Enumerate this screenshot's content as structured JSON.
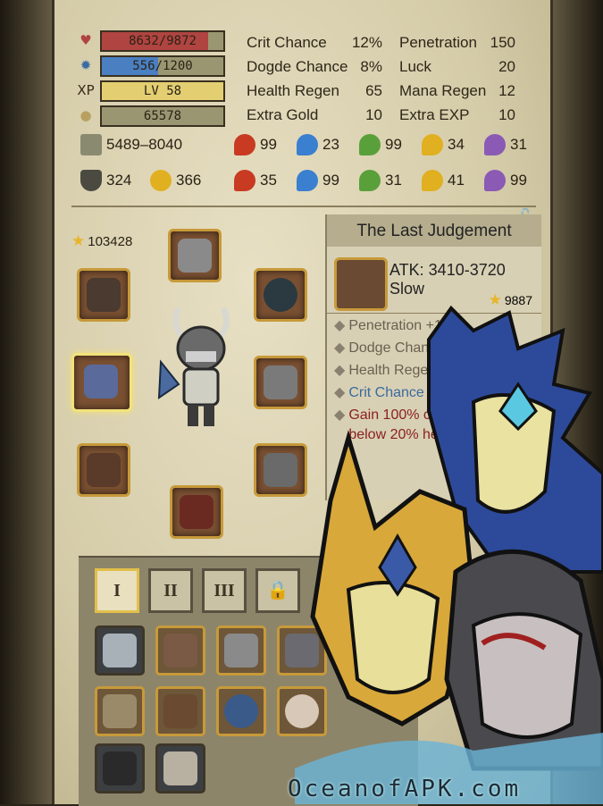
{
  "stats_bars": [
    {
      "icon": "heart-icon",
      "label": "8632/9872",
      "fill": 0.874,
      "color": "#b04440"
    },
    {
      "icon": "mana-icon",
      "label": "556/1200",
      "fill": 0.463,
      "color": "#4a7fc2"
    },
    {
      "icon": "xp-icon",
      "icon_text": "XP",
      "label": "LV 58",
      "fill": 1.0,
      "color": "#e3cf72"
    },
    {
      "icon": "gold-icon",
      "label": "65578",
      "fill": 0,
      "color": "#9b9672"
    }
  ],
  "stats_left": [
    {
      "label": "Crit Chance",
      "value": "12%"
    },
    {
      "label": "Dogde Chance",
      "value": "8%"
    },
    {
      "label": "Health Regen",
      "value": "65"
    },
    {
      "label": "Extra Gold",
      "value": "10"
    }
  ],
  "stats_right": [
    {
      "label": "Penetration",
      "value": "150"
    },
    {
      "label": "Luck",
      "value": "20"
    },
    {
      "label": "Mana Regen",
      "value": "12"
    },
    {
      "label": "Extra EXP",
      "value": "10"
    }
  ],
  "attack": {
    "icon": "crossed-swords-icon",
    "value": "5489–8040"
  },
  "defense": [
    {
      "icon": "shield-icon",
      "value": "324"
    },
    {
      "icon": "magic-staff-icon",
      "value": "366"
    }
  ],
  "elements_atk": [
    {
      "icon": "fire-icon",
      "value": "99",
      "color": "#c83a22"
    },
    {
      "icon": "water-icon",
      "value": "23",
      "color": "#3a7fd0"
    },
    {
      "icon": "leaf-icon",
      "value": "99",
      "color": "#5aa03a"
    },
    {
      "icon": "lightning-icon",
      "value": "34",
      "color": "#e0b020"
    },
    {
      "icon": "arcane-icon",
      "value": "31",
      "color": "#8a5ab4"
    }
  ],
  "elements_def": [
    {
      "icon": "fire-shield-icon",
      "value": "35",
      "color": "#c83a22"
    },
    {
      "icon": "water-shield-icon",
      "value": "99",
      "color": "#3a7fd0"
    },
    {
      "icon": "leaf-shield-icon",
      "value": "31",
      "color": "#5aa03a"
    },
    {
      "icon": "lightning-shield-icon",
      "value": "41",
      "color": "#e0b020"
    },
    {
      "icon": "arcane-shield-icon",
      "value": "99",
      "color": "#8a5ab4"
    }
  ],
  "gear_score": "103428",
  "equipment": [
    {
      "name": "helmet-slot",
      "icon": "helmet-icon"
    },
    {
      "name": "amulet-slot",
      "icon": "skull-amulet-icon"
    },
    {
      "name": "ring-slot",
      "icon": "ring-icon"
    },
    {
      "name": "weapon-slot",
      "icon": "axe-icon",
      "selected": true
    },
    {
      "name": "armor-slot",
      "icon": "armor-icon"
    },
    {
      "name": "gloves-slot",
      "icon": "gauntlet-icon"
    },
    {
      "name": "pants-slot",
      "icon": "greaves-icon"
    },
    {
      "name": "boots-slot",
      "icon": "boots-icon"
    }
  ],
  "tooltip": {
    "title": "The Last Judgement",
    "atk": "ATK: 3410-3720",
    "effect": "Slow",
    "score": "9887",
    "attributes": [
      {
        "text": "Penetration +138",
        "color": "#6a6050"
      },
      {
        "text": "Dodge Chance +5%",
        "color": "#6a6050"
      },
      {
        "text": "Health Regen +50",
        "color": "#6a6050"
      },
      {
        "text": "Crit Chance +5%",
        "color": "#3a6aa0"
      },
      {
        "text": "Gain 100% crit c",
        "color": "#8a2020"
      },
      {
        "text": "below 20% health",
        "color": "#8a2020"
      }
    ]
  },
  "inventory_tabs": [
    {
      "label": "I",
      "active": true
    },
    {
      "label": "II",
      "active": false
    },
    {
      "label": "III",
      "active": false
    },
    {
      "label": "",
      "icon": "lock-icon",
      "active": false
    }
  ],
  "inventory_items": [
    {
      "icon": "sword-icon",
      "rare": false
    },
    {
      "icon": "hammer-icon",
      "rare": true
    },
    {
      "icon": "knight-helm-icon",
      "rare": true
    },
    {
      "icon": "winged-helm-icon",
      "rare": true
    },
    {
      "icon": "chest-armor-icon",
      "rare": true
    },
    {
      "icon": "leather-boots-icon",
      "rare": true
    },
    {
      "icon": "serpent-ring-icon",
      "rare": true
    },
    {
      "icon": "eye-amulet-icon",
      "rare": true
    },
    {
      "icon": "chain-icon",
      "rare": false
    },
    {
      "icon": "bracer-icon",
      "rare": false
    }
  ],
  "watermark": "OceanofAPK.com"
}
